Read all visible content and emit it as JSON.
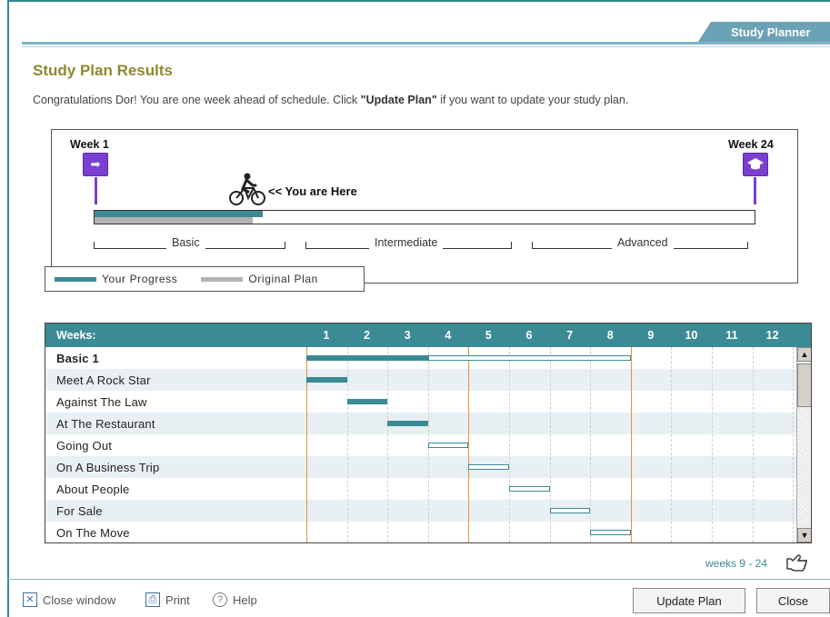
{
  "header": {
    "tab_label": "Study Planner"
  },
  "page": {
    "title": "Study Plan Results",
    "intro_prefix": "Congratulations Dor! You are one week ahead of schedule. Click ",
    "intro_bold": "\"Update Plan\"",
    "intro_suffix": " if you want to update your study plan."
  },
  "progress": {
    "start_label": "Week 1",
    "end_label": "Week 24",
    "here_label": "<< You are Here",
    "progress_fraction": 0.255,
    "plan_fraction": 0.24,
    "stages": [
      "Basic",
      "Intermediate",
      "Advanced"
    ],
    "legend": {
      "progress": "Your Progress",
      "plan": "Original Plan"
    },
    "colors": {
      "progress": "#3b8a94",
      "plan": "#b3b3b3",
      "flag": "#7a3fd0"
    }
  },
  "schedule": {
    "header_label": "Weeks:",
    "weeks": [
      "1",
      "2",
      "3",
      "4",
      "5",
      "6",
      "7",
      "8",
      "9",
      "10",
      "11",
      "12"
    ],
    "rows": [
      {
        "label": "Basic 1",
        "bold": true,
        "start": 1,
        "end": 9,
        "done_until": 4
      },
      {
        "label": "Meet A Rock Star",
        "start": 1,
        "end": 2,
        "done_until": 2
      },
      {
        "label": "Against The Law",
        "start": 2,
        "end": 3,
        "done_until": 3
      },
      {
        "label": "At The Restaurant",
        "start": 3,
        "end": 4,
        "done_until": 4
      },
      {
        "label": "Going Out",
        "start": 4,
        "end": 5,
        "done_until": 4
      },
      {
        "label": "On A Business Trip",
        "start": 5,
        "end": 6,
        "done_until": 5
      },
      {
        "label": "About People",
        "start": 6,
        "end": 7,
        "done_until": 6
      },
      {
        "label": "For Sale",
        "start": 7,
        "end": 8,
        "done_until": 7
      },
      {
        "label": "On The Move",
        "start": 8,
        "end": 9,
        "done_until": 8
      }
    ],
    "current_week_marker": 5,
    "plan_end_marker": 9
  },
  "pager": {
    "label": "weeks 9 - 24"
  },
  "footer": {
    "close_window": "Close window",
    "print": "Print",
    "help": "Help",
    "update_button": "Update Plan",
    "close_button": "Close"
  }
}
